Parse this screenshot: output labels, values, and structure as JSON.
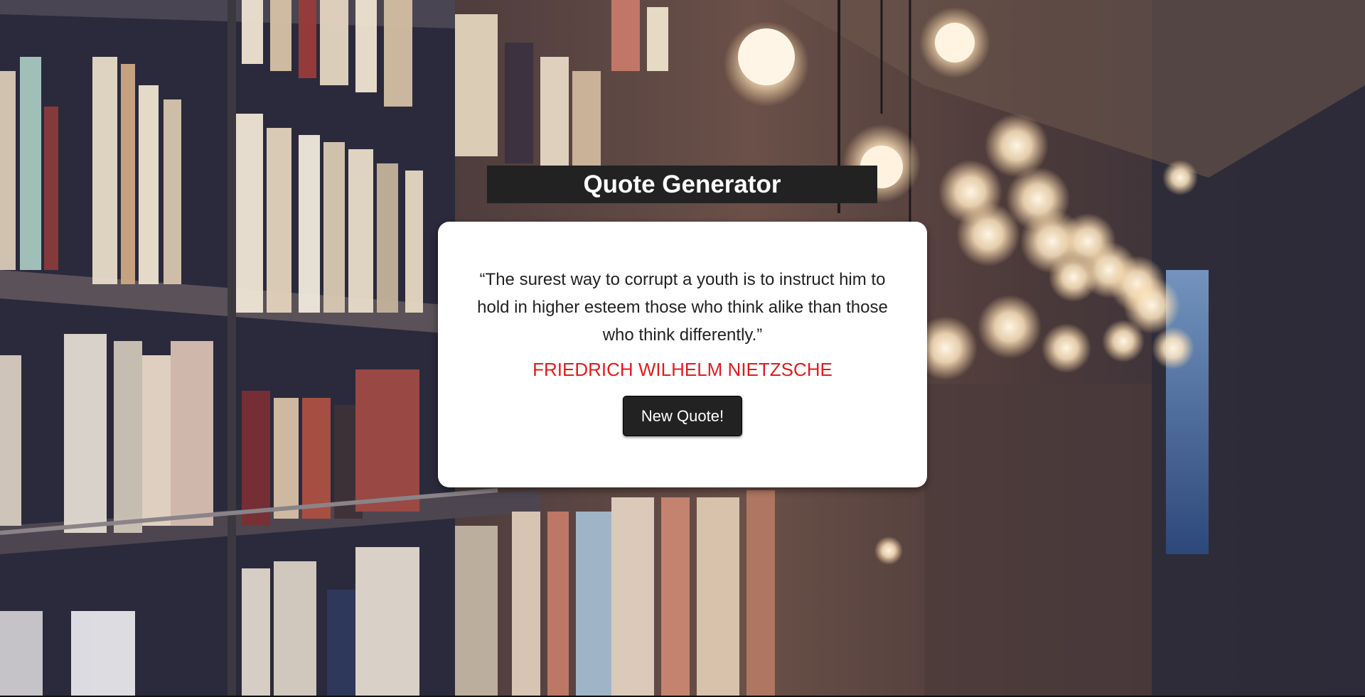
{
  "header": {
    "title": "Quote Generator"
  },
  "quote": {
    "text": "“The surest way to corrupt a youth is to instruct him to hold in higher esteem those who think alike than those who think differently.”",
    "author": "FRIEDRICH WILHELM NIETZSCHE"
  },
  "actions": {
    "new_quote_label": "New Quote!"
  },
  "colors": {
    "title_bar": "#222222",
    "card": "#ffffff",
    "author": "#e31b1b",
    "button": "#222222"
  }
}
